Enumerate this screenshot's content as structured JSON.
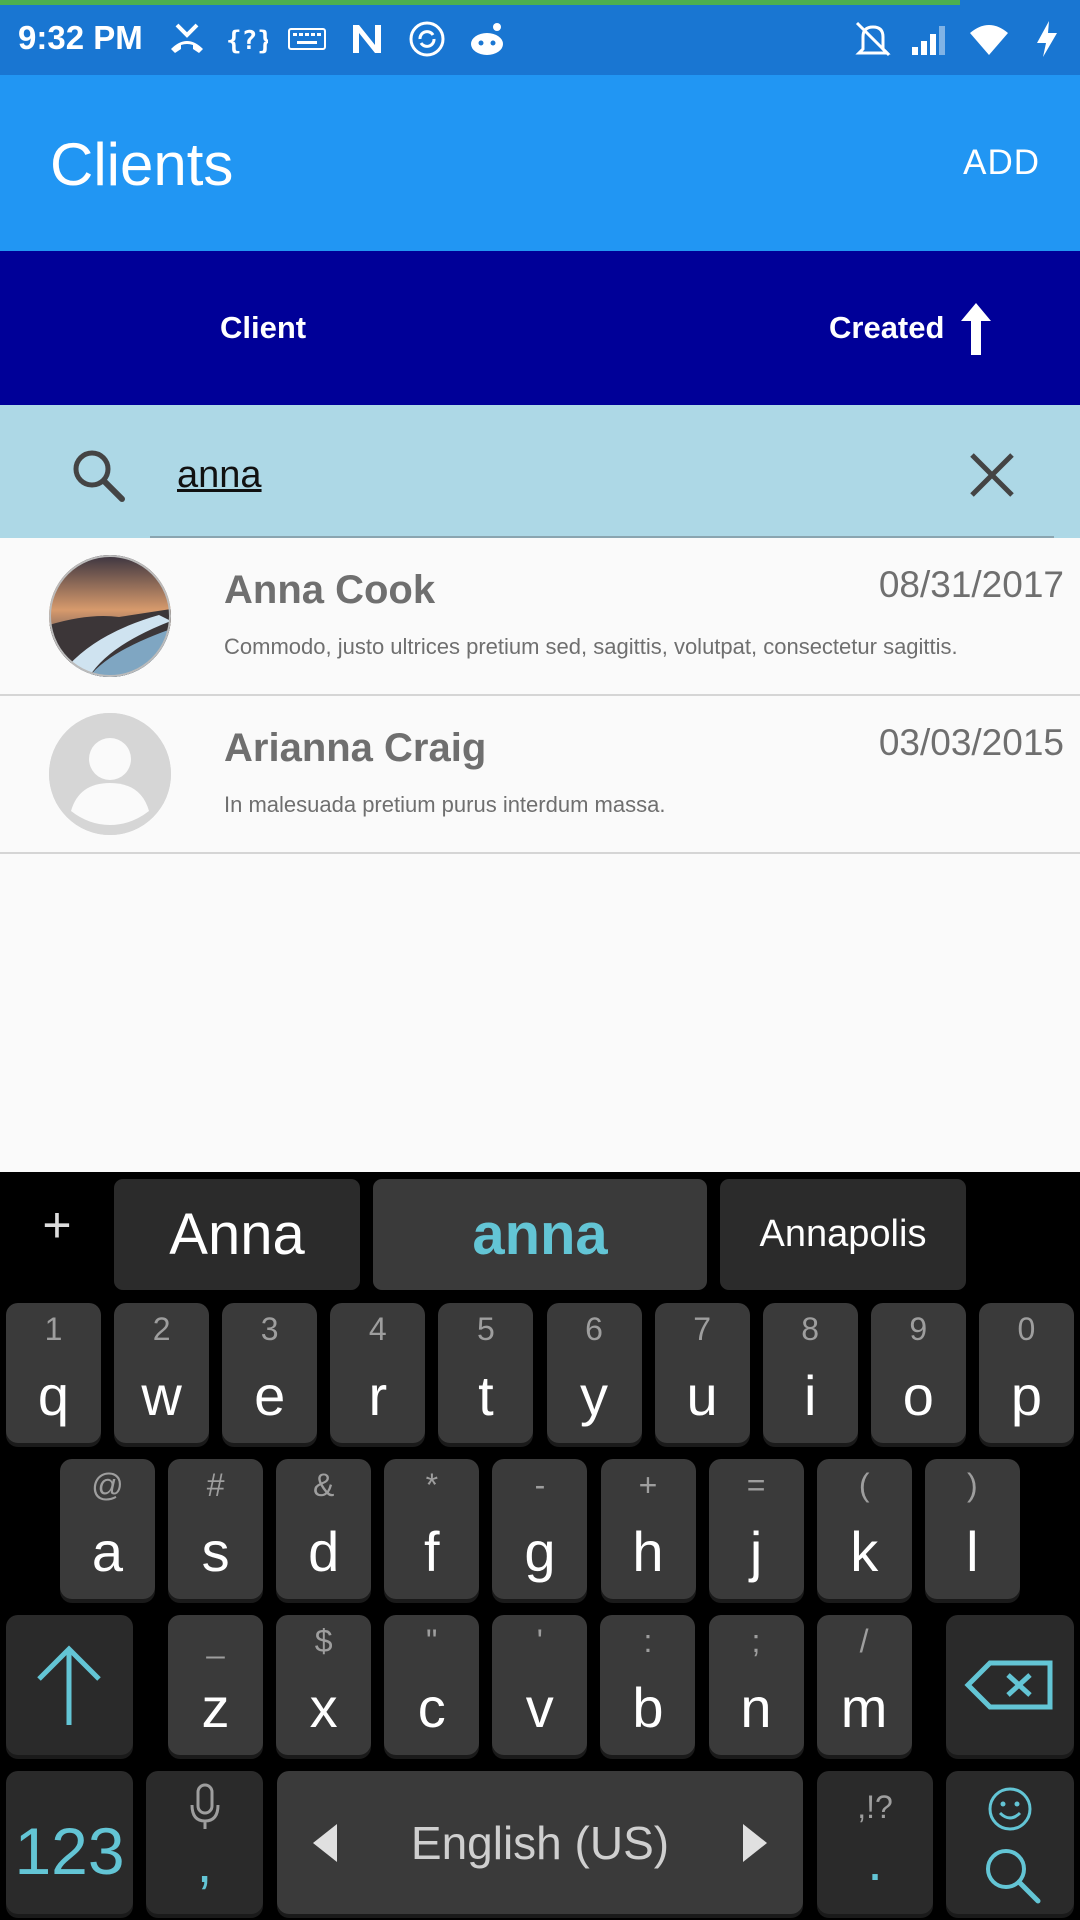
{
  "status_bar": {
    "time": "9:32 PM",
    "left_icons": [
      "missed-call-icon",
      "unknown-app-icon",
      "keyboard-icon",
      "n-app-icon",
      "sync-icon",
      "reddit-icon"
    ],
    "right_icons": [
      "mute-bell-icon",
      "cell-signal-icon",
      "wifi-icon",
      "charging-icon"
    ]
  },
  "app_bar": {
    "title": "Clients",
    "add_label": "ADD"
  },
  "sort_header": {
    "client_label": "Client",
    "created_label": "Created",
    "sort_direction_icon": "arrow-up-icon"
  },
  "search": {
    "value": "anna",
    "icon": "search-icon",
    "clear_icon": "close-icon"
  },
  "clients": [
    {
      "name": "Anna Cook",
      "date": "08/31/2017",
      "description": "Commodo, justo ultrices pretium sed, sagittis, volutpat, consectetur sagittis.",
      "avatar": "photo"
    },
    {
      "name": "Arianna Craig",
      "date": "03/03/2015",
      "description": "In malesuada pretium purus interdum massa.",
      "avatar": "placeholder"
    }
  ],
  "keyboard": {
    "suggestions": [
      "Anna",
      "anna",
      "Annapolis"
    ],
    "plus": "+",
    "row1": [
      {
        "main": "q",
        "alt": "1"
      },
      {
        "main": "w",
        "alt": "2"
      },
      {
        "main": "e",
        "alt": "3"
      },
      {
        "main": "r",
        "alt": "4"
      },
      {
        "main": "t",
        "alt": "5"
      },
      {
        "main": "y",
        "alt": "6"
      },
      {
        "main": "u",
        "alt": "7"
      },
      {
        "main": "i",
        "alt": "8"
      },
      {
        "main": "o",
        "alt": "9"
      },
      {
        "main": "p",
        "alt": "0"
      }
    ],
    "row2": [
      {
        "main": "a",
        "alt": "@"
      },
      {
        "main": "s",
        "alt": "#"
      },
      {
        "main": "d",
        "alt": "&"
      },
      {
        "main": "f",
        "alt": "*"
      },
      {
        "main": "g",
        "alt": "-"
      },
      {
        "main": "h",
        "alt": "+"
      },
      {
        "main": "j",
        "alt": "="
      },
      {
        "main": "k",
        "alt": "("
      },
      {
        "main": "l",
        "alt": ")"
      }
    ],
    "row3": [
      {
        "main": "z",
        "alt": "_"
      },
      {
        "main": "x",
        "alt": "$"
      },
      {
        "main": "c",
        "alt": "\""
      },
      {
        "main": "v",
        "alt": "'"
      },
      {
        "main": "b",
        "alt": ":"
      },
      {
        "main": "n",
        "alt": ";"
      },
      {
        "main": "m",
        "alt": "/"
      }
    ],
    "numbers_key": "123",
    "comma_key": ",",
    "space_label": "English (US)",
    "period_key": ".",
    "period_alt": ",!?",
    "accent_color": "#63c5d5"
  }
}
